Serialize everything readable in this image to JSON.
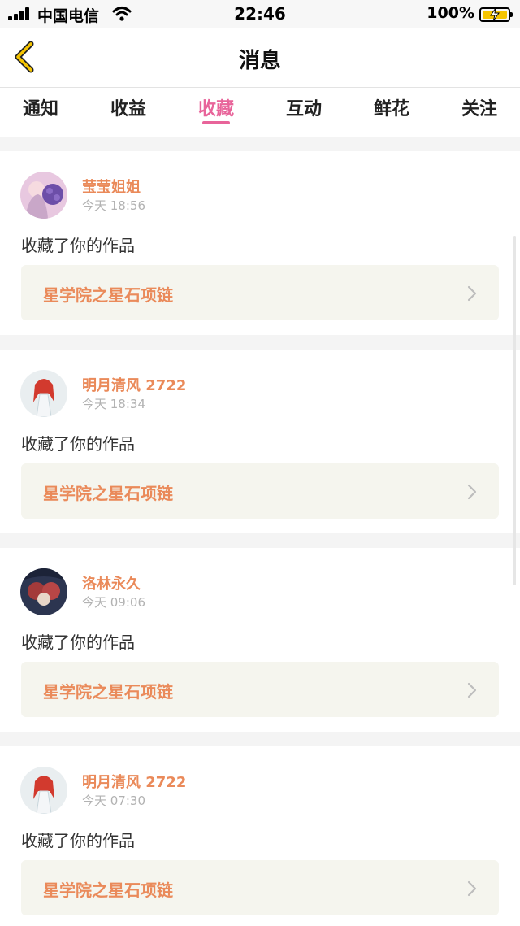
{
  "status_bar": {
    "carrier": "中国电信",
    "time": "22:46",
    "battery": "100%",
    "battery_color": "#f5c400"
  },
  "nav": {
    "back_icon": "chevron-left-icon",
    "title": "消息"
  },
  "tabs": [
    {
      "label": "通知"
    },
    {
      "label": "收益"
    },
    {
      "label": "收藏"
    },
    {
      "label": "互动"
    },
    {
      "label": "鲜花"
    },
    {
      "label": "关注"
    }
  ],
  "active_tab": "收藏",
  "accent_color": "#e8649a",
  "name_color": "#ea8a5a",
  "messages": [
    {
      "user": "莹莹姐姐",
      "time": "今天 18:56",
      "action": "收藏了你的作品",
      "work": "星学院之星石项链"
    },
    {
      "user": "明月清风 2722",
      "time": "今天 18:34",
      "action": "收藏了你的作品",
      "work": "星学院之星石项链"
    },
    {
      "user": "洛林永久",
      "time": "今天 09:06",
      "action": "收藏了你的作品",
      "work": "星学院之星石项链"
    },
    {
      "user": "明月清风 2722",
      "time": "今天 07:30",
      "action": "收藏了你的作品",
      "work": "星学院之星石项链"
    }
  ]
}
